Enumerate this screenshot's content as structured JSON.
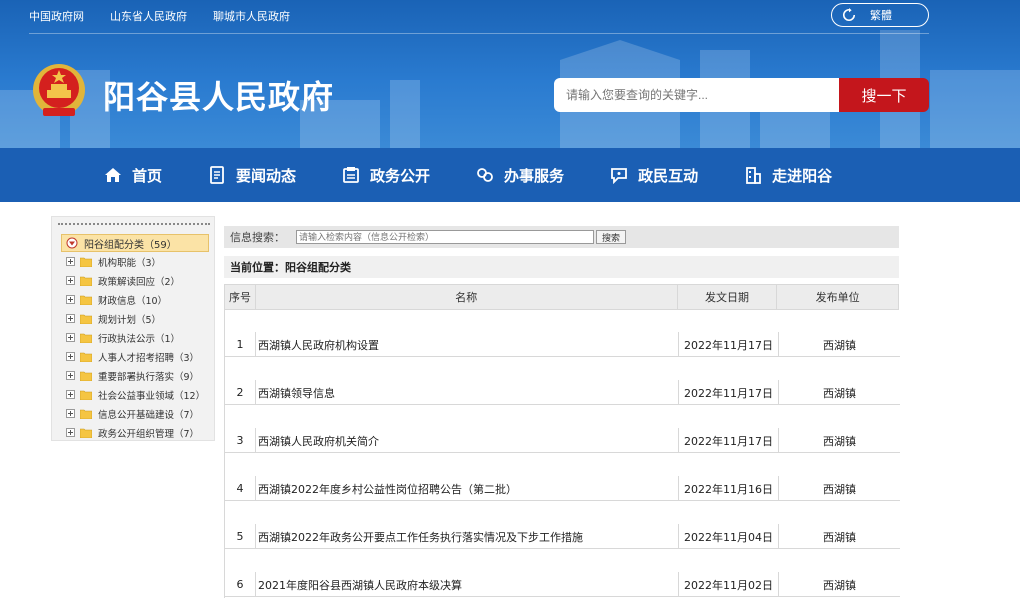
{
  "top_links": [
    "中国政府网",
    "山东省人民政府",
    "聊城市人民政府"
  ],
  "trad_button": "繁體",
  "site_title": "阳谷县人民政府",
  "search": {
    "placeholder": "请输入您要查询的关键字...",
    "button": "搜一下"
  },
  "nav": [
    {
      "label": "首页",
      "icon": "home-icon"
    },
    {
      "label": "要闻动态",
      "icon": "document-icon"
    },
    {
      "label": "政务公开",
      "icon": "notice-icon"
    },
    {
      "label": "办事服务",
      "icon": "handshake-icon"
    },
    {
      "label": "政民互动",
      "icon": "chat-icon"
    },
    {
      "label": "走进阳谷",
      "icon": "building-icon"
    }
  ],
  "sidebar": {
    "root": "阳谷组配分类（59）",
    "items": [
      {
        "label": "机构职能（3）"
      },
      {
        "label": "政策解读回应（2）"
      },
      {
        "label": "财政信息（10）"
      },
      {
        "label": "规划计划（5）"
      },
      {
        "label": "行政执法公示（1）"
      },
      {
        "label": "人事人才招考招聘（3）"
      },
      {
        "label": "重要部署执行落实（9）"
      },
      {
        "label": "社会公益事业领域（12）"
      },
      {
        "label": "信息公开基础建设（7）"
      },
      {
        "label": "政务公开组织管理（7）"
      }
    ]
  },
  "info_search": {
    "label": "信息搜索：",
    "placeholder": "请输入检索内容（信息公开检索）",
    "button": "搜索"
  },
  "location": "当前位置：阳谷组配分类",
  "table": {
    "headers": [
      "序号",
      "名称",
      "发文日期",
      "发布单位"
    ],
    "rows": [
      {
        "no": "1",
        "title": "西湖镇人民政府机构设置",
        "date": "2022年11月17日",
        "unit": "西湖镇"
      },
      {
        "no": "2",
        "title": "西湖镇领导信息",
        "date": "2022年11月17日",
        "unit": "西湖镇"
      },
      {
        "no": "3",
        "title": "西湖镇人民政府机关简介",
        "date": "2022年11月17日",
        "unit": "西湖镇"
      },
      {
        "no": "4",
        "title": "西湖镇2022年度乡村公益性岗位招聘公告（第二批）",
        "date": "2022年11月16日",
        "unit": "西湖镇"
      },
      {
        "no": "5",
        "title": "西湖镇2022年政务公开要点工作任务执行落实情况及下步工作措施",
        "date": "2022年11月04日",
        "unit": "西湖镇"
      },
      {
        "no": "6",
        "title": "2021年度阳谷县西湖镇人民政府本级决算",
        "date": "2022年11月02日",
        "unit": "西湖镇"
      }
    ]
  },
  "colors": {
    "header_blue": "#1b5fb4",
    "search_red": "#c4161c",
    "sidebar_root_bg": "#fbe3a6"
  }
}
